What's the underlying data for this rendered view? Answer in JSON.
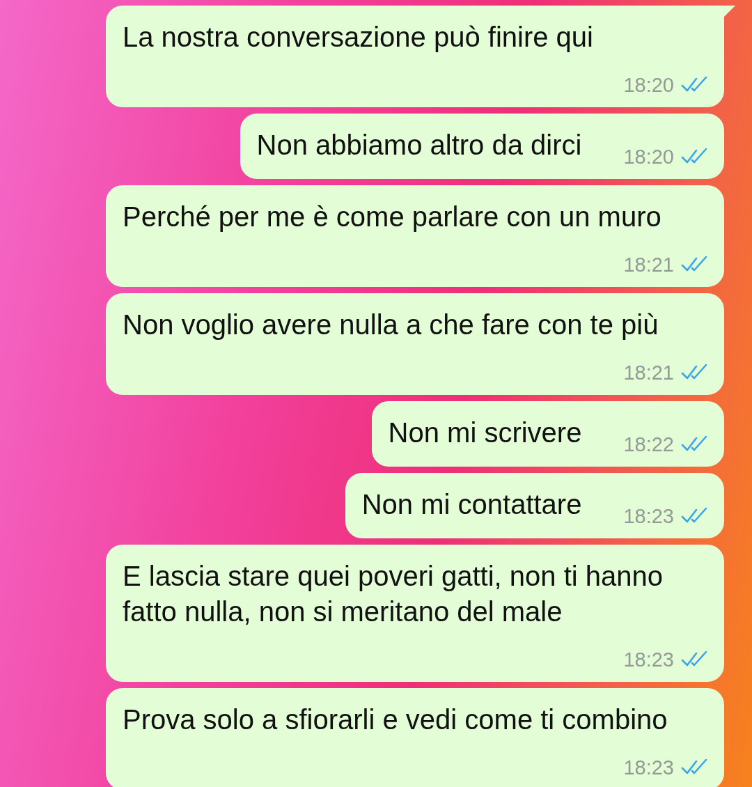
{
  "messages": [
    {
      "text": "La nostra conversazione può finire qui",
      "time": "18:20",
      "read": true,
      "tail": true
    },
    {
      "text": "Non abbiamo altro da dirci",
      "time": "18:20",
      "read": true,
      "tail": false
    },
    {
      "text": "Perché per me è come parlare con un muro",
      "time": "18:21",
      "read": true,
      "tail": false
    },
    {
      "text": "Non voglio avere nulla a che fare con te più",
      "time": "18:21",
      "read": true,
      "tail": false
    },
    {
      "text": "Non mi scrivere",
      "time": "18:22",
      "read": true,
      "tail": false
    },
    {
      "text": "Non mi contattare",
      "time": "18:23",
      "read": true,
      "tail": false
    },
    {
      "text": "E lascia stare quei poveri gatti, non ti hanno fatto nulla, non si meritano del male",
      "time": "18:23",
      "read": true,
      "tail": false
    },
    {
      "text": "Prova solo a sfiorarli e vedi come ti combino",
      "time": "18:23",
      "read": true,
      "tail": false
    }
  ]
}
